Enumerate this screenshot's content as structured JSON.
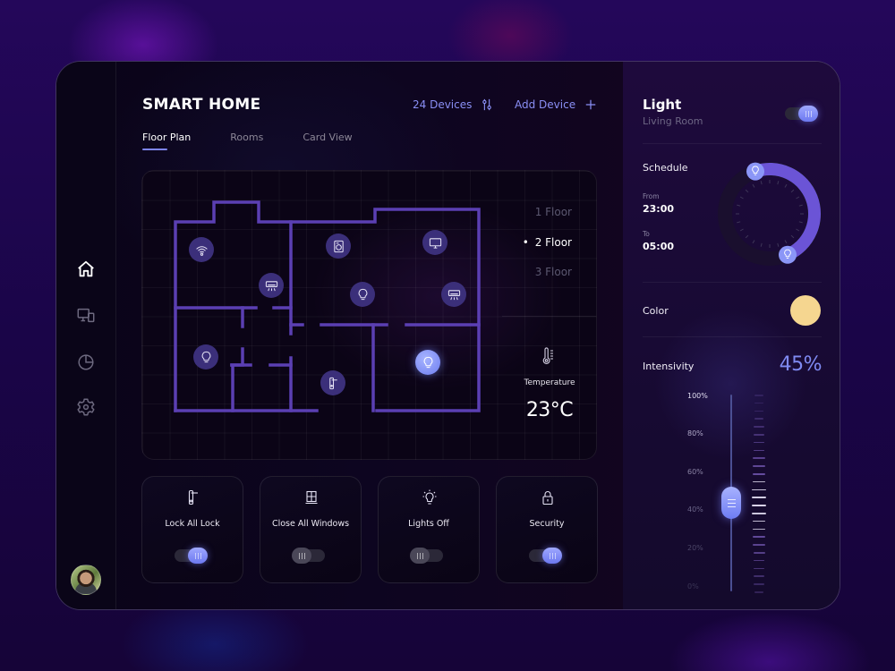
{
  "app": {
    "title": "SMART HOME"
  },
  "header": {
    "devices_label": "24 Devices",
    "devices_icon": "sliders-icon",
    "add_device_label": "Add Device",
    "add_icon": "plus-icon"
  },
  "tabs": [
    {
      "label": "Floor Plan",
      "active": true
    },
    {
      "label": "Rooms",
      "active": false
    },
    {
      "label": "Card View",
      "active": false
    }
  ],
  "sidebar": {
    "items": [
      {
        "name": "home",
        "icon": "home-icon",
        "active": true
      },
      {
        "name": "devices",
        "icon": "devices-icon",
        "active": false
      },
      {
        "name": "statistics",
        "icon": "pie-chart-icon",
        "active": false
      },
      {
        "name": "settings",
        "icon": "gear-icon",
        "active": false
      }
    ],
    "avatar": "user-avatar"
  },
  "floor_plan": {
    "floors": [
      {
        "label": "1 Floor",
        "active": false
      },
      {
        "label": "2 Floor",
        "active": true
      },
      {
        "label": "3 Floor",
        "active": false
      }
    ],
    "devices": [
      {
        "type": "wifi-router",
        "icon": "wifi-icon",
        "on": false
      },
      {
        "type": "air-conditioner",
        "icon": "air-conditioner-icon",
        "on": false
      },
      {
        "type": "washing-machine",
        "icon": "washing-machine-icon",
        "on": false
      },
      {
        "type": "tv",
        "icon": "tv-icon",
        "on": false
      },
      {
        "type": "light",
        "icon": "lightbulb-icon",
        "on": false
      },
      {
        "type": "air-conditioner",
        "icon": "air-conditioner-icon",
        "on": false
      },
      {
        "type": "light",
        "icon": "lightbulb-icon",
        "on": false
      },
      {
        "type": "door-lock",
        "icon": "door-handle-icon",
        "on": false
      },
      {
        "type": "light",
        "icon": "lightbulb-icon",
        "on": true
      }
    ],
    "temperature": {
      "label": "Temperature",
      "value": "23°C",
      "icon": "thermometer-icon"
    }
  },
  "quick_actions": [
    {
      "label": "Lock All Lock",
      "icon": "door-handle-icon",
      "on": true
    },
    {
      "label": "Close All Windows",
      "icon": "window-icon",
      "on": false
    },
    {
      "label": "Lights Off",
      "icon": "lightbulb-icon",
      "on": false
    },
    {
      "label": "Security",
      "icon": "padlock-icon",
      "on": true
    }
  ],
  "light_panel": {
    "title": "Light",
    "room": "Living Room",
    "power_on": true,
    "schedule": {
      "label": "Schedule",
      "from_label": "From",
      "from": "23:00",
      "to_label": "To",
      "to": "05:00"
    },
    "color": {
      "label": "Color",
      "value": "#F5D690"
    },
    "intensity": {
      "label": "Intensivity",
      "value_text": "45%",
      "value": 45,
      "scale": [
        "100%",
        "80%",
        "60%",
        "40%",
        "20%",
        "0%"
      ]
    }
  },
  "colors": {
    "accent": "#7D84F0",
    "wall": "#5B3FB3",
    "device_bg": "#3B2F7A",
    "panel_bg": "#1E0A3C"
  }
}
